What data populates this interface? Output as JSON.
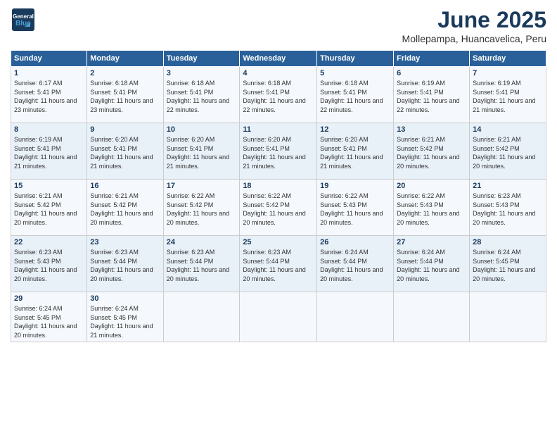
{
  "header": {
    "logo_line1": "General",
    "logo_line2": "Blue",
    "month": "June 2025",
    "location": "Mollepampa, Huancavelica, Peru"
  },
  "days_of_week": [
    "Sunday",
    "Monday",
    "Tuesday",
    "Wednesday",
    "Thursday",
    "Friday",
    "Saturday"
  ],
  "weeks": [
    [
      {
        "day": "1",
        "sunrise": "6:17 AM",
        "sunset": "5:41 PM",
        "daylight": "11 hours and 23 minutes."
      },
      {
        "day": "2",
        "sunrise": "6:18 AM",
        "sunset": "5:41 PM",
        "daylight": "11 hours and 23 minutes."
      },
      {
        "day": "3",
        "sunrise": "6:18 AM",
        "sunset": "5:41 PM",
        "daylight": "11 hours and 22 minutes."
      },
      {
        "day": "4",
        "sunrise": "6:18 AM",
        "sunset": "5:41 PM",
        "daylight": "11 hours and 22 minutes."
      },
      {
        "day": "5",
        "sunrise": "6:18 AM",
        "sunset": "5:41 PM",
        "daylight": "11 hours and 22 minutes."
      },
      {
        "day": "6",
        "sunrise": "6:19 AM",
        "sunset": "5:41 PM",
        "daylight": "11 hours and 22 minutes."
      },
      {
        "day": "7",
        "sunrise": "6:19 AM",
        "sunset": "5:41 PM",
        "daylight": "11 hours and 21 minutes."
      }
    ],
    [
      {
        "day": "8",
        "sunrise": "6:19 AM",
        "sunset": "5:41 PM",
        "daylight": "11 hours and 21 minutes."
      },
      {
        "day": "9",
        "sunrise": "6:20 AM",
        "sunset": "5:41 PM",
        "daylight": "11 hours and 21 minutes."
      },
      {
        "day": "10",
        "sunrise": "6:20 AM",
        "sunset": "5:41 PM",
        "daylight": "11 hours and 21 minutes."
      },
      {
        "day": "11",
        "sunrise": "6:20 AM",
        "sunset": "5:41 PM",
        "daylight": "11 hours and 21 minutes."
      },
      {
        "day": "12",
        "sunrise": "6:20 AM",
        "sunset": "5:41 PM",
        "daylight": "11 hours and 21 minutes."
      },
      {
        "day": "13",
        "sunrise": "6:21 AM",
        "sunset": "5:42 PM",
        "daylight": "11 hours and 20 minutes."
      },
      {
        "day": "14",
        "sunrise": "6:21 AM",
        "sunset": "5:42 PM",
        "daylight": "11 hours and 20 minutes."
      }
    ],
    [
      {
        "day": "15",
        "sunrise": "6:21 AM",
        "sunset": "5:42 PM",
        "daylight": "11 hours and 20 minutes."
      },
      {
        "day": "16",
        "sunrise": "6:21 AM",
        "sunset": "5:42 PM",
        "daylight": "11 hours and 20 minutes."
      },
      {
        "day": "17",
        "sunrise": "6:22 AM",
        "sunset": "5:42 PM",
        "daylight": "11 hours and 20 minutes."
      },
      {
        "day": "18",
        "sunrise": "6:22 AM",
        "sunset": "5:42 PM",
        "daylight": "11 hours and 20 minutes."
      },
      {
        "day": "19",
        "sunrise": "6:22 AM",
        "sunset": "5:43 PM",
        "daylight": "11 hours and 20 minutes."
      },
      {
        "day": "20",
        "sunrise": "6:22 AM",
        "sunset": "5:43 PM",
        "daylight": "11 hours and 20 minutes."
      },
      {
        "day": "21",
        "sunrise": "6:23 AM",
        "sunset": "5:43 PM",
        "daylight": "11 hours and 20 minutes."
      }
    ],
    [
      {
        "day": "22",
        "sunrise": "6:23 AM",
        "sunset": "5:43 PM",
        "daylight": "11 hours and 20 minutes."
      },
      {
        "day": "23",
        "sunrise": "6:23 AM",
        "sunset": "5:44 PM",
        "daylight": "11 hours and 20 minutes."
      },
      {
        "day": "24",
        "sunrise": "6:23 AM",
        "sunset": "5:44 PM",
        "daylight": "11 hours and 20 minutes."
      },
      {
        "day": "25",
        "sunrise": "6:23 AM",
        "sunset": "5:44 PM",
        "daylight": "11 hours and 20 minutes."
      },
      {
        "day": "26",
        "sunrise": "6:24 AM",
        "sunset": "5:44 PM",
        "daylight": "11 hours and 20 minutes."
      },
      {
        "day": "27",
        "sunrise": "6:24 AM",
        "sunset": "5:44 PM",
        "daylight": "11 hours and 20 minutes."
      },
      {
        "day": "28",
        "sunrise": "6:24 AM",
        "sunset": "5:45 PM",
        "daylight": "11 hours and 20 minutes."
      }
    ],
    [
      {
        "day": "29",
        "sunrise": "6:24 AM",
        "sunset": "5:45 PM",
        "daylight": "11 hours and 20 minutes."
      },
      {
        "day": "30",
        "sunrise": "6:24 AM",
        "sunset": "5:45 PM",
        "daylight": "11 hours and 21 minutes."
      },
      null,
      null,
      null,
      null,
      null
    ]
  ]
}
